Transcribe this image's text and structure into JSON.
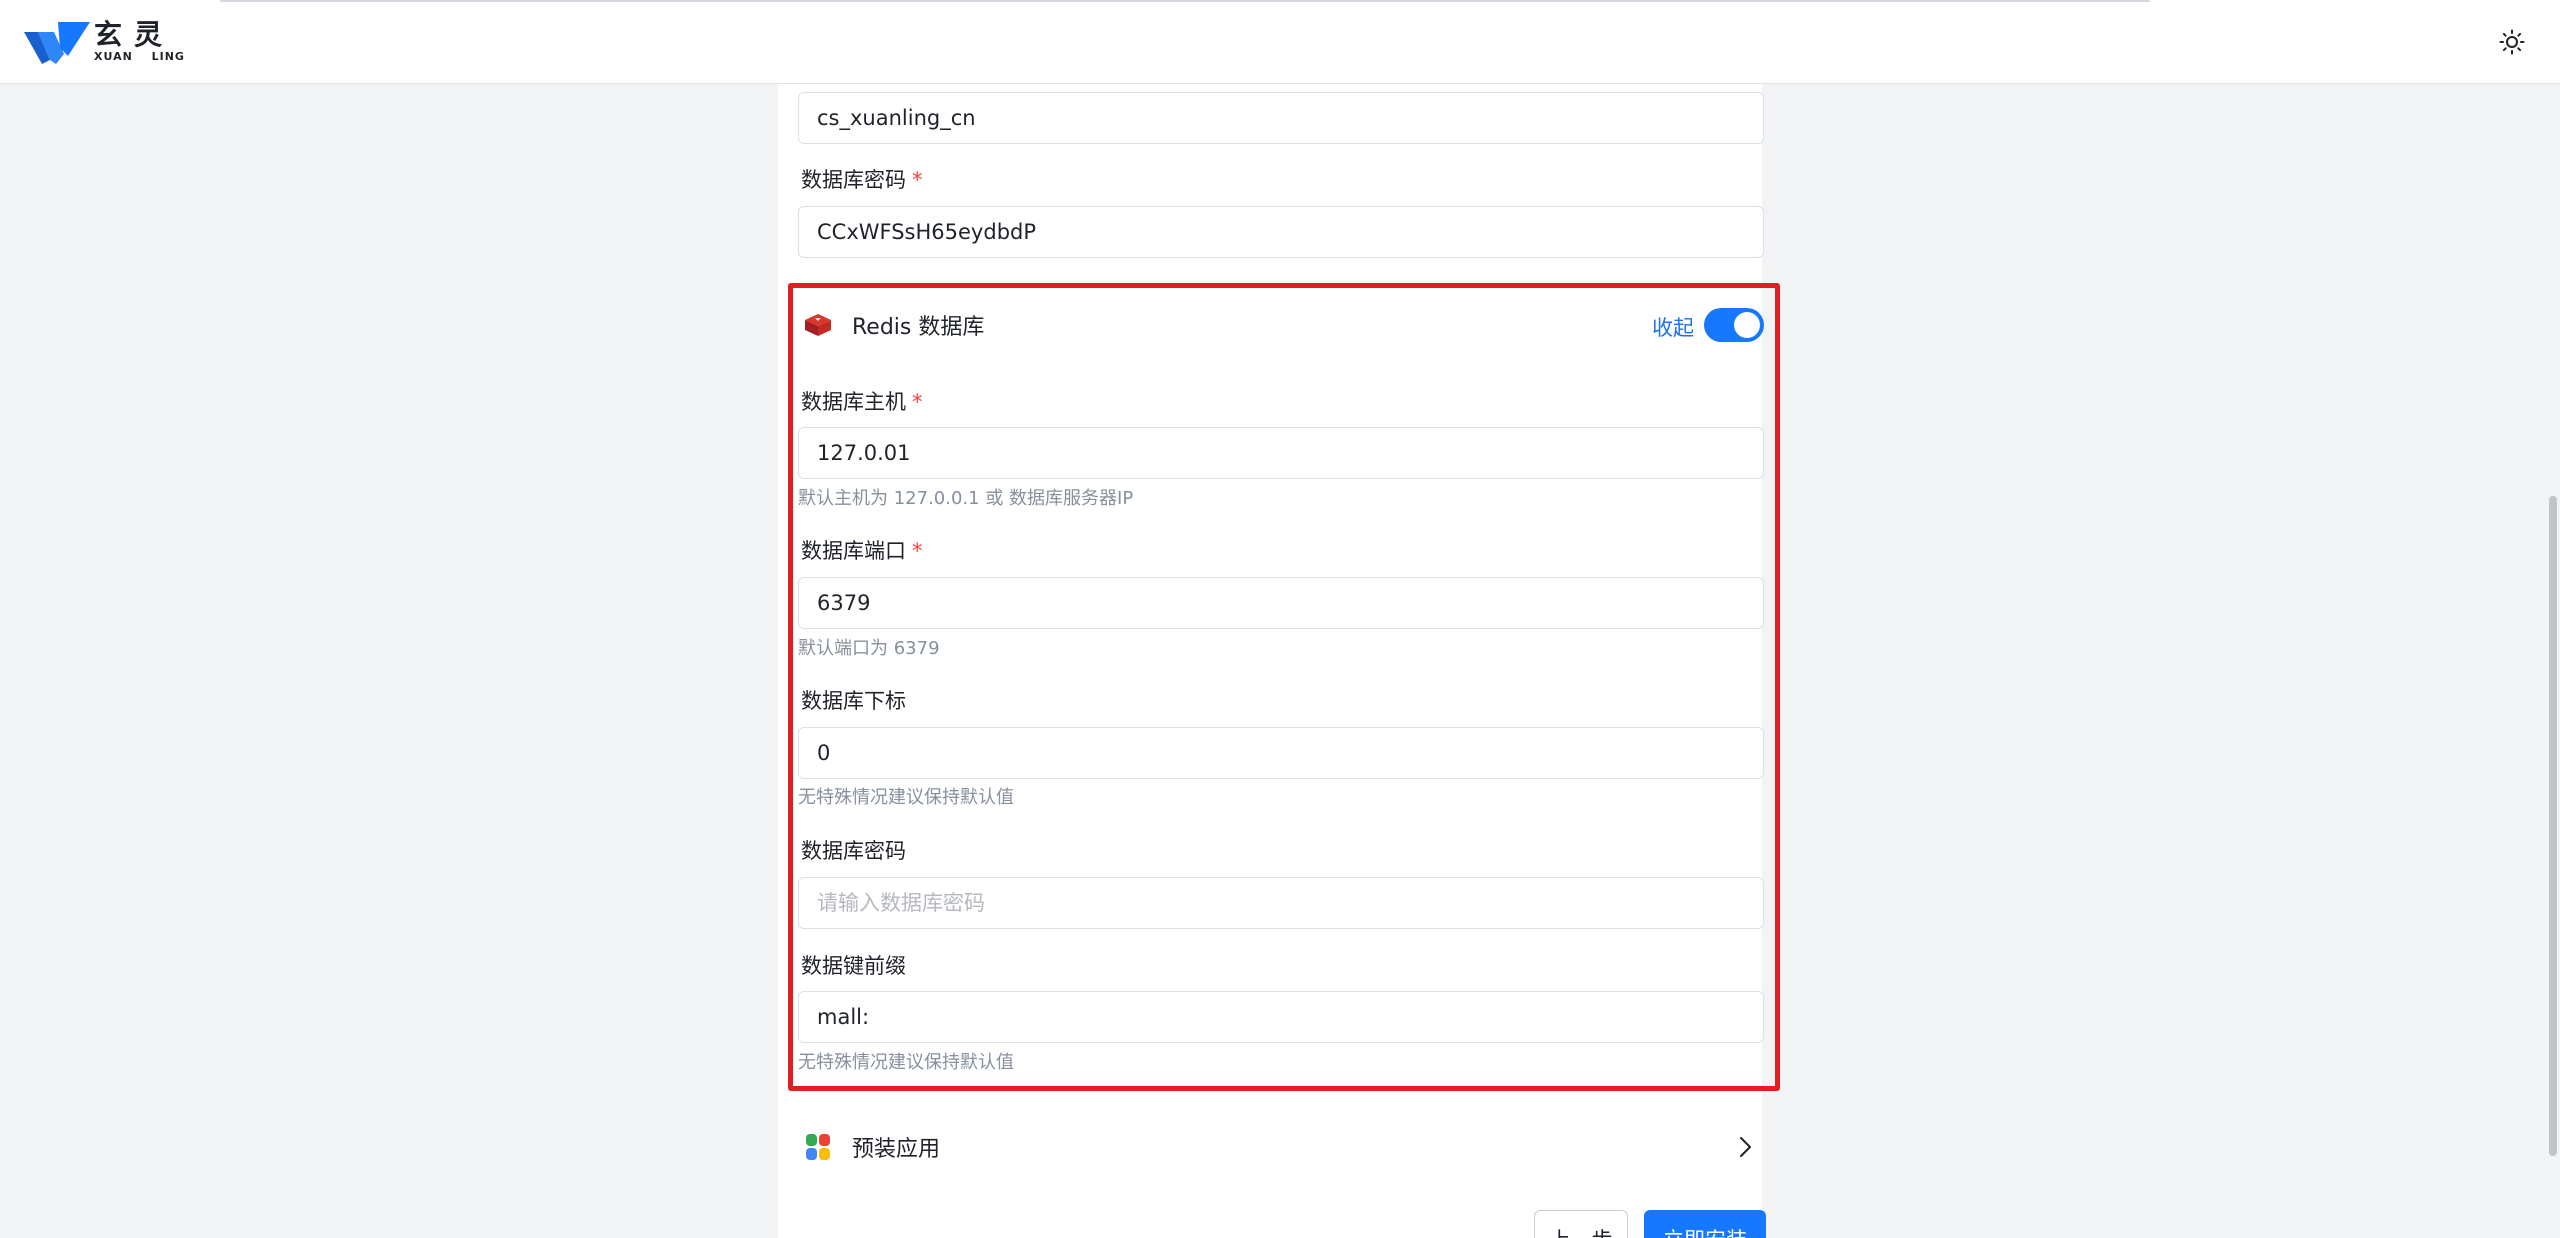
{
  "brand": {
    "name_cn": "玄灵",
    "name_en": "XUAN LING",
    "accent_color": "#1677ff"
  },
  "header": {
    "theme_toggle_icon": "sun-icon"
  },
  "fields_top": {
    "db_user_value": "cs_xuanling_cn",
    "db_password_label": "数据库密码",
    "db_password_value": "CCxWFSsH65eydbdP"
  },
  "redis": {
    "title": "Redis 数据库",
    "icon": "redis-cube-icon",
    "collapse_label": "收起",
    "toggle_on": true,
    "host_label": "数据库主机",
    "host_value": "127.0.01",
    "host_hint": "默认主机为 127.0.0.1 或 数据库服务器IP",
    "port_label": "数据库端口",
    "port_value": "6379",
    "port_hint": "默认端口为 6379",
    "index_label": "数据库下标",
    "index_value": "0",
    "index_hint": "无特殊情况建议保持默认值",
    "password_label": "数据库密码",
    "password_placeholder": "请输入数据库密码",
    "prefix_label": "数据键前缀",
    "prefix_value": "mall:",
    "prefix_hint": "无特殊情况建议保持默认值",
    "highlight_color": "#e02020"
  },
  "preinstall": {
    "title": "预装应用",
    "icon": "apps-grid-icon"
  },
  "actions": {
    "prev_label": "上一步",
    "install_label": "立即安装"
  },
  "required_mark": "*"
}
